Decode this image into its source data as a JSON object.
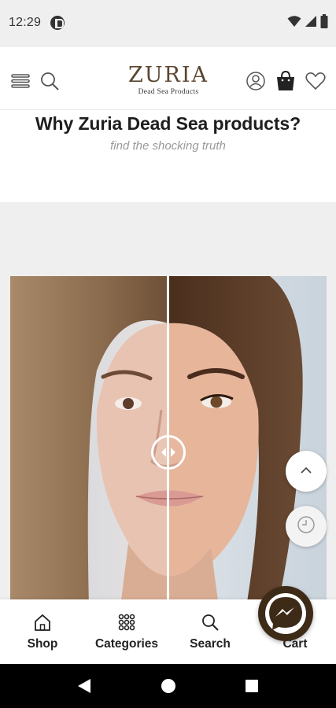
{
  "status_bar": {
    "time": "12:29",
    "app_icon": "pocket-icon",
    "indicators": [
      "wifi-icon",
      "signal-icon",
      "battery-icon"
    ]
  },
  "header": {
    "logo_main": "ZURIA",
    "logo_sub": "Dead Sea Products",
    "left_icons": [
      "menu-icon",
      "search-icon"
    ],
    "right_icons": [
      "account-icon",
      "bag-icon",
      "heart-icon"
    ]
  },
  "hero": {
    "headline": "Why Zuria Dead Sea products?",
    "subheadline": "find the shocking truth"
  },
  "comparison": {
    "handle_icon": "left-right-arrows-icon"
  },
  "fabs": {
    "scroll_top_icon": "chevron-up-icon",
    "history_icon": "clock-icon"
  },
  "bottom_nav": {
    "items": [
      {
        "label": "Shop",
        "icon": "home-icon"
      },
      {
        "label": "Categories",
        "icon": "grid-icon"
      },
      {
        "label": "Search",
        "icon": "search-icon"
      },
      {
        "label": "Cart",
        "icon": "cart-icon"
      }
    ]
  },
  "messenger": {
    "icon": "messenger-icon"
  },
  "system_nav": [
    "back-icon",
    "home-circle-icon",
    "recents-icon"
  ],
  "colors": {
    "brand_brown": "#5a4530",
    "messenger_bg": "#3d2a17",
    "section_gray": "#efefef"
  }
}
